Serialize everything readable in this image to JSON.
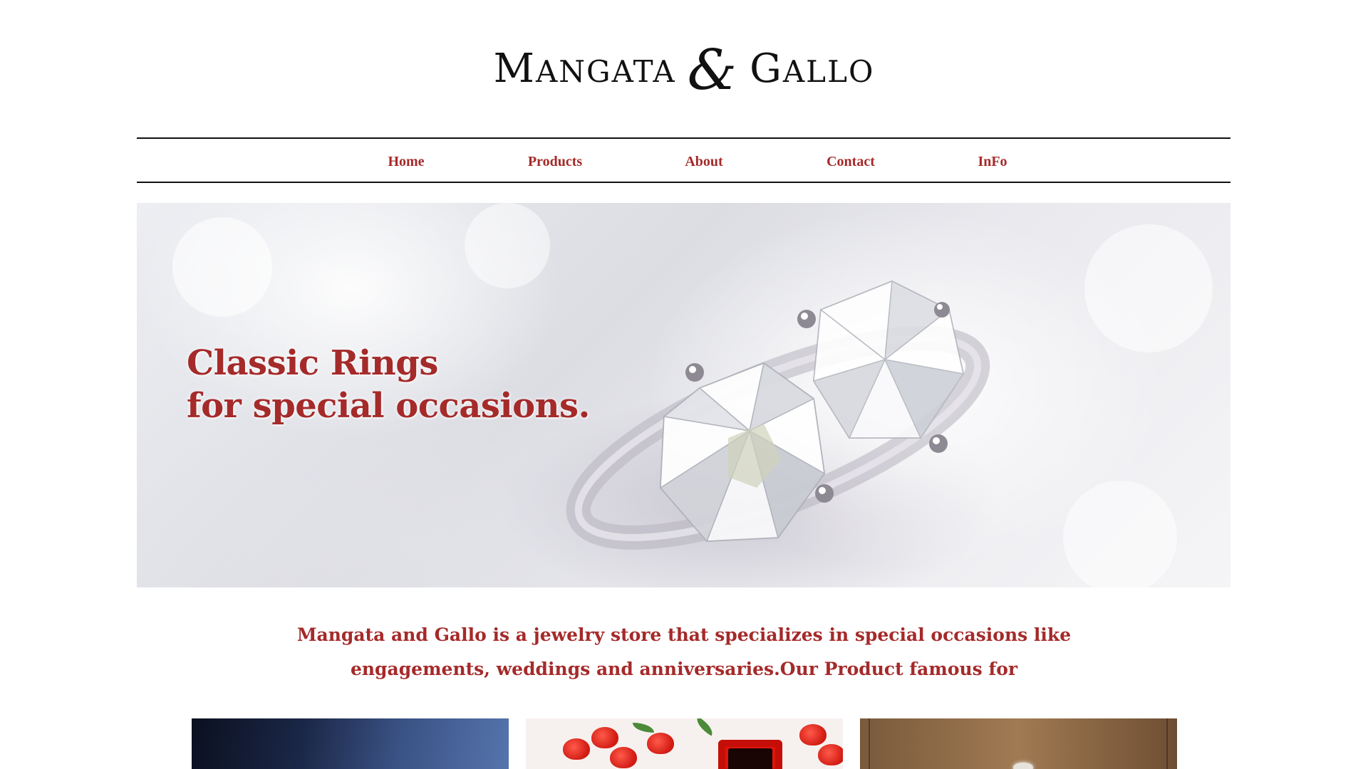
{
  "brand": {
    "name_first": "Mangata",
    "ampersand": "&",
    "name_second": "Gallo"
  },
  "nav": {
    "items": [
      {
        "label": "Home"
      },
      {
        "label": "Products"
      },
      {
        "label": "About"
      },
      {
        "label": "Contact"
      },
      {
        "label": "InFo"
      }
    ]
  },
  "hero": {
    "headline_line1": "Classic Rings",
    "headline_line2": "for special occasions."
  },
  "intro": {
    "text": "Mangata and Gallo is a jewelry store that specializes in special occasions like engagements, weddings and anniversaries.Our Product famous for"
  },
  "colors": {
    "accent": "#a52a2a",
    "rule": "#111111",
    "background": "#ffffff"
  }
}
